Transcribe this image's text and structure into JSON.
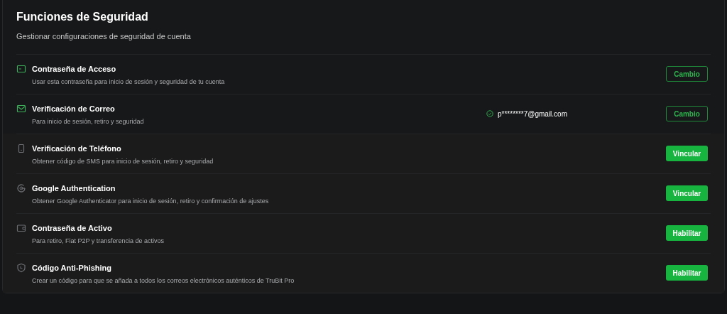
{
  "header": {
    "title": "Funciones de Seguridad",
    "subtitle": "Gestionar configuraciones de seguridad de cuenta"
  },
  "items": [
    {
      "kind": "password",
      "title": "Contraseña de Acceso",
      "description": "Usar esta contraseña para inicio de sesión y seguridad de tu cuenta",
      "enabled": true,
      "button": "Cambio"
    },
    {
      "kind": "mail",
      "title": "Verificación de Correo",
      "description": "Para inicio de sesión, retiro y seguridad",
      "enabled": true,
      "value": "p********7@gmail.com",
      "button": "Cambio"
    },
    {
      "kind": "phone",
      "title": "Verificación de Teléfono",
      "description": "Obtener código de SMS para inicio de sesión, retiro y seguridad",
      "enabled": false,
      "button": "Vincular"
    },
    {
      "kind": "google",
      "title": "Google Authentication",
      "description": "Obtener Google Authenticator para inicio de sesión, retiro y confirmación de ajustes",
      "enabled": false,
      "button": "Vincular"
    },
    {
      "kind": "wallet",
      "title": "Contraseña de Activo",
      "description": "Para retiro, Fiat P2P y transferencia de activos",
      "enabled": false,
      "button": "Habilitar"
    },
    {
      "kind": "shield",
      "title": "Código Anti-Phishing",
      "description": "Crear un código para que se añada a todos los correos electrónicos auténticos de TruBit Pro",
      "enabled": false,
      "button": "Habilitar"
    }
  ]
}
